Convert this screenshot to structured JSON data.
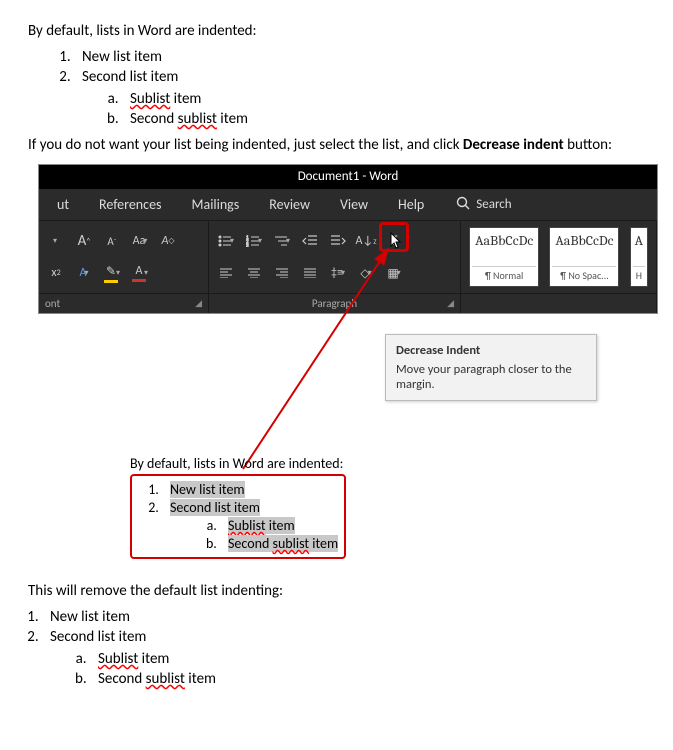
{
  "intro_text": "By default, lists in Word are indented:",
  "list1": {
    "item1": "New list item",
    "item2": "Second list item",
    "sub1_pre": "Sublist",
    "sub1_post": " item",
    "sub2_pre": "Second ",
    "sub2_mid": "sublist",
    "sub2_post": " item"
  },
  "para2_pre": "If you do not want your list being indented, just select the list, and click ",
  "para2_bold": "Decrease indent",
  "para2_post": " button:",
  "ribbon": {
    "title": "Document1  -  Word",
    "tab_cutoff": "ut",
    "tabs": [
      "References",
      "Mailings",
      "Review",
      "View",
      "Help"
    ],
    "search": "Search",
    "group_font_cutoff": "ont",
    "group_paragraph": "Paragraph",
    "styles": [
      {
        "sample": "AaBbCcDc",
        "name": "¶ Normal"
      },
      {
        "sample": "AaBbCcDc",
        "name": "¶ No Spac..."
      },
      {
        "sample": "A",
        "name": "H"
      }
    ]
  },
  "tooltip": {
    "title": "Decrease Indent",
    "body": "Move your paragraph closer to the margin."
  },
  "snippet_caption": "By default, lists in Word are indented:",
  "para3": "This will remove the default list indenting:"
}
